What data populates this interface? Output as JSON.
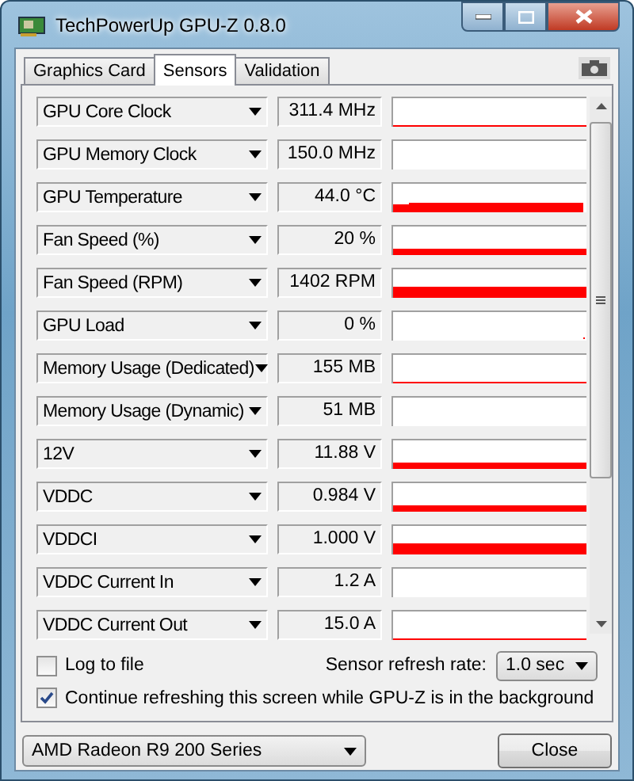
{
  "window": {
    "title": "TechPowerUp GPU-Z 0.8.0"
  },
  "tabs": [
    {
      "label": "Graphics Card",
      "selected": false
    },
    {
      "label": "Sensors",
      "selected": true
    },
    {
      "label": "Validation",
      "selected": false
    }
  ],
  "sensors": [
    {
      "name": "GPU Core Clock",
      "value": "311.4 MHz"
    },
    {
      "name": "GPU Memory Clock",
      "value": "150.0 MHz"
    },
    {
      "name": "GPU Temperature",
      "value": "44.0 °C"
    },
    {
      "name": "Fan Speed (%)",
      "value": "20 %"
    },
    {
      "name": "Fan Speed (RPM)",
      "value": "1402 RPM"
    },
    {
      "name": "GPU Load",
      "value": "0 %"
    },
    {
      "name": "Memory Usage (Dedicated)",
      "value": "155 MB"
    },
    {
      "name": "Memory Usage (Dynamic)",
      "value": "51 MB"
    },
    {
      "name": "12V",
      "value": "11.88 V"
    },
    {
      "name": "VDDC",
      "value": "0.984 V"
    },
    {
      "name": "VDDCI",
      "value": "1.000 V"
    },
    {
      "name": "VDDC Current In",
      "value": "1.2 A"
    },
    {
      "name": "VDDC Current Out",
      "value": "15.0 A"
    }
  ],
  "log_to_file": {
    "label": "Log to file",
    "checked": false
  },
  "refresh_rate": {
    "label": "Sensor refresh rate:",
    "value": "1.0 sec"
  },
  "continue_refreshing": {
    "label": "Continue refreshing this screen while GPU-Z is in the background",
    "checked": true
  },
  "gpu_select": {
    "value": "AMD Radeon R9 200 Series"
  },
  "close_button": {
    "label": "Close"
  }
}
